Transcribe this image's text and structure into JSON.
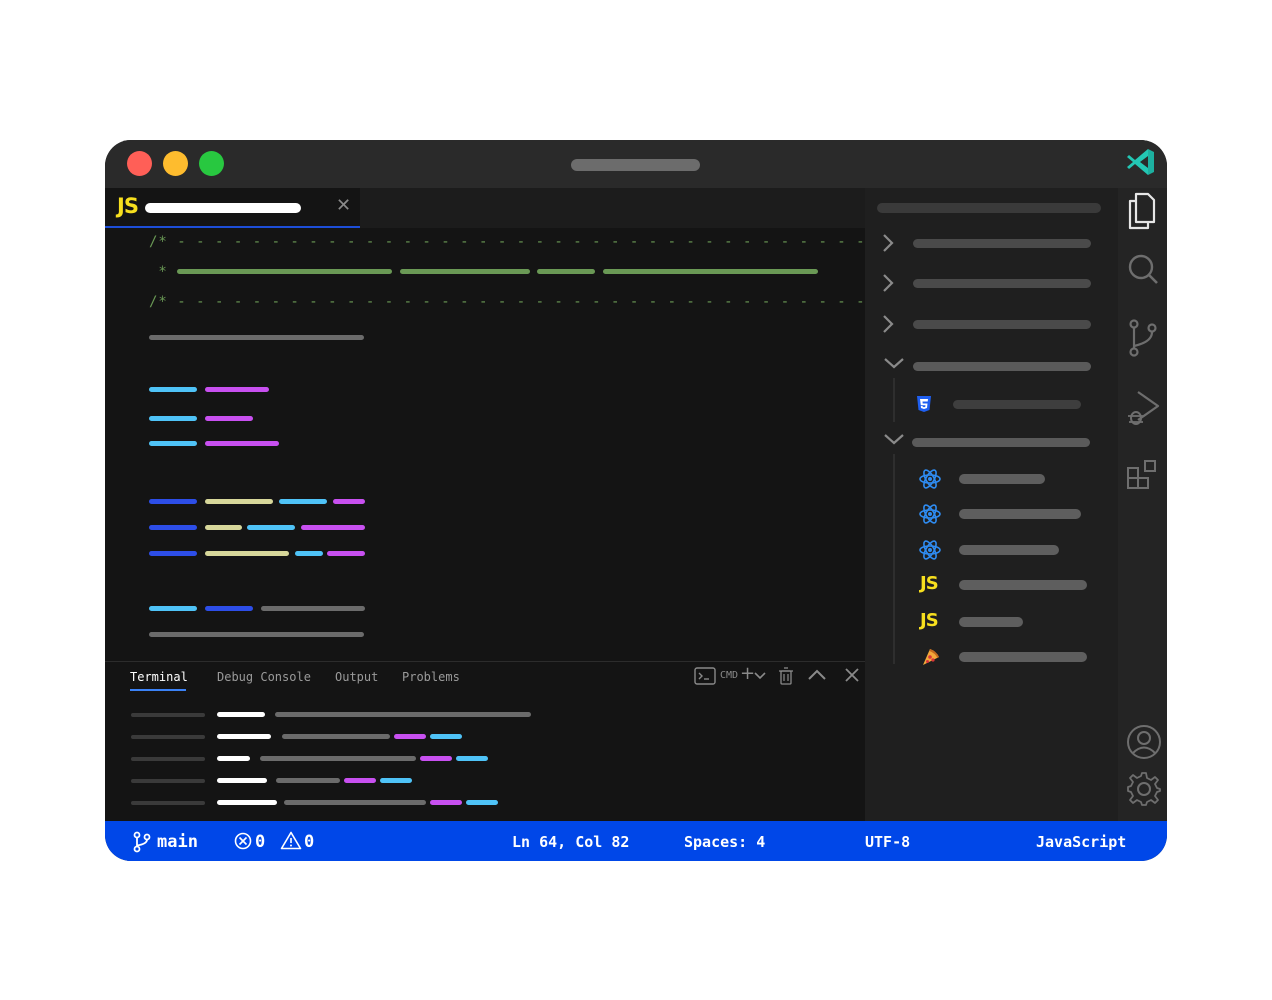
{
  "window": {
    "traffic_lights": [
      "#ff5f57",
      "#febc2e",
      "#28c840"
    ]
  },
  "editor": {
    "tab": {
      "language_badge": "JS"
    },
    "code_comment_open": "/* - - - - - - - - - - - - - - - - - - - - - - - - - - - - - - - - - - - - - -",
    "code_comment_star": " *",
    "code_comment_close": "/* - - - - - - - - - - - - - - - - - - - - - - - - - - - - - - - - - - - - - -"
  },
  "panel": {
    "tabs": [
      "Terminal",
      "Debug Console",
      "Output",
      "Problems"
    ],
    "active_tab": "Terminal",
    "cmd_label": "CMD"
  },
  "sidebar": {
    "file_icons": [
      "css-icon",
      "react-icon",
      "react-icon",
      "react-icon",
      "js-icon",
      "js-icon",
      "pizza-icon"
    ],
    "js_label": "JS"
  },
  "activity_bar": {
    "icons": [
      "files-icon",
      "search-icon",
      "source-control-icon",
      "run-debug-icon",
      "extensions-icon",
      "account-icon",
      "settings-gear-icon"
    ]
  },
  "status_bar": {
    "branch": "main",
    "errors": "0",
    "warnings": "0",
    "position": "Ln 64, Col 82",
    "spaces": "Spaces: 4",
    "encoding": "UTF-8",
    "language": "JavaScript",
    "color": "#0047e8"
  }
}
